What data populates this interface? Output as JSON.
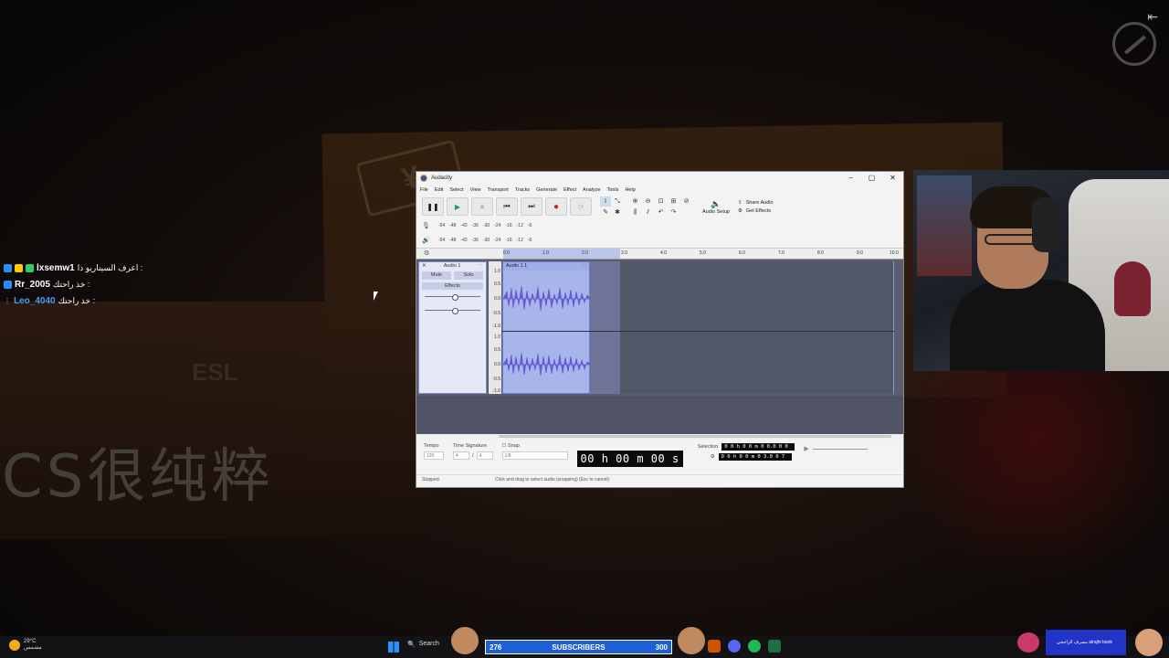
{
  "chat": {
    "messages": [
      {
        "user": "lxsemw1",
        "text": ": اعرف السيناريو ذا",
        "user_color": "#ffffff"
      },
      {
        "user": "Rr_2005",
        "text": ": خذ راحتك",
        "user_color": "#ffffff"
      },
      {
        "user": "Leo_4040",
        "text": ": خذ راحتك",
        "user_color": "#4a9eff"
      }
    ]
  },
  "background": {
    "chinese_text": "CS很纯粹",
    "esl_text": "ESL"
  },
  "audacity": {
    "title": "Audacity",
    "menu": [
      "File",
      "Edit",
      "Select",
      "View",
      "Transport",
      "Tracks",
      "Generate",
      "Effect",
      "Analyze",
      "Tools",
      "Help"
    ],
    "toolbar": {
      "audio_setup": "Audio Setup",
      "share_audio": "Share Audio",
      "get_effects": "Get Effects"
    },
    "meter_scale": [
      "-54",
      "-48",
      "-42",
      "-36",
      "-30",
      "-24",
      "-18",
      "-12",
      "-6"
    ],
    "ruler_ticks": [
      "0.0",
      "1.0",
      "2.0",
      "3.0",
      "4.0",
      "5.0",
      "6.0",
      "7.0",
      "8.0",
      "9.0",
      "10.0"
    ],
    "track": {
      "name": "Audio 1",
      "clip_name": "Audio 1.1",
      "mute": "Mute",
      "solo": "Solo",
      "effects": "Effects",
      "scale": [
        "1.0",
        "0.5",
        "0.0",
        "-0.5",
        "-1.0"
      ]
    },
    "bottom": {
      "tempo_label": "Tempo",
      "tempo_value": "120",
      "time_signature_label": "Time Signature",
      "ts_num": "4",
      "ts_den": "4",
      "snap_label": "Snap",
      "snap_value": "1/8",
      "time_display": "00 h 00 m 00 s",
      "selection_label": "Selection",
      "sel_start": "0 0 h 0 0 m 0 0.0 0 0 s",
      "sel_end": "0 0 h 0 0 m 0 3.0 0 7 s"
    },
    "status": {
      "state": "Stopped.",
      "hint": "Click and drag to select audio (snapping) (Esc to cancel)"
    }
  },
  "taskbar": {
    "weather_temp": "29°C",
    "weather_desc": "مشمس",
    "search_label": "Search",
    "subscribers": {
      "left": "276",
      "label": "SUBSCRIBERS",
      "right": "300"
    },
    "bank_text": "مصرف الراجحي alrajhi bank"
  }
}
